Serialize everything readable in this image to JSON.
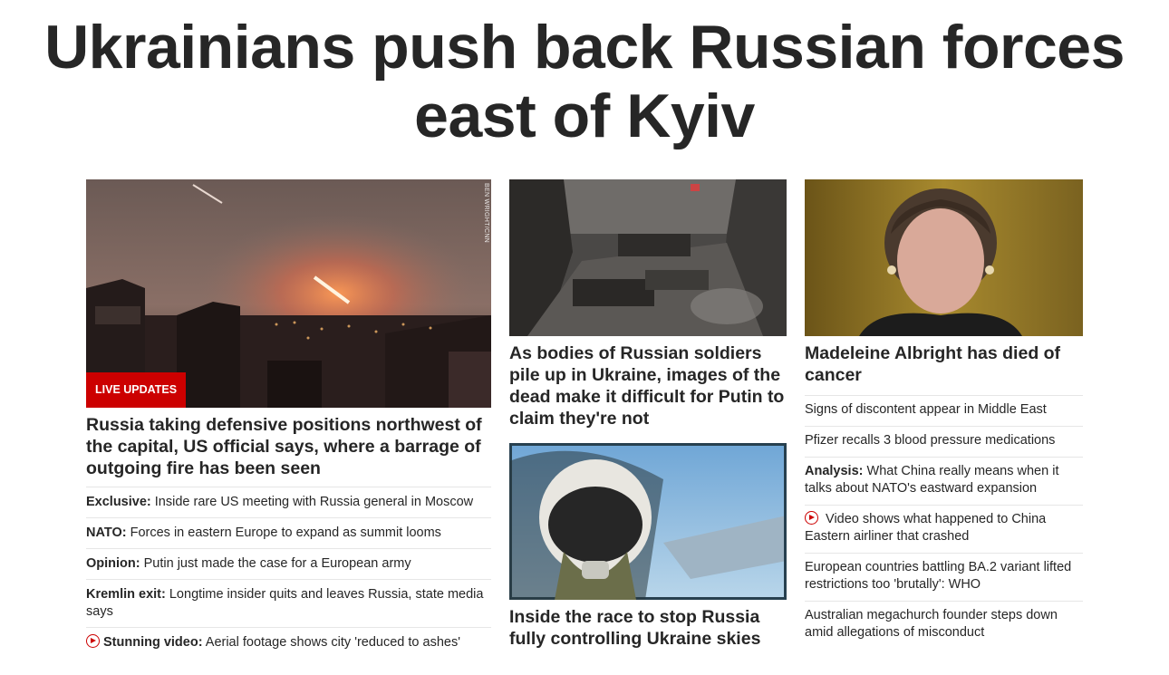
{
  "headline": "Ukrainians push back Russian forces east of Kyiv",
  "col1": {
    "image_credit": "BEN WRIGHT/CNN",
    "badge": "LIVE UPDATES",
    "lead": "Russia taking defensive positions northwest of the capital, US official says, where a barrage of outgoing fire has been seen",
    "items": [
      {
        "label": "Exclusive:",
        "text": " Inside rare US meeting with Russia general in Moscow",
        "video": false
      },
      {
        "label": "NATO:",
        "text": " Forces in eastern Europe to expand as summit looms",
        "video": false
      },
      {
        "label": "Opinion:",
        "text": " Putin just made the case for a European army",
        "video": false
      },
      {
        "label": "Kremlin exit:",
        "text": " Longtime insider quits and leaves Russia, state media says",
        "video": false
      },
      {
        "label": "Stunning video:",
        "text": " Aerial footage shows city 'reduced to ashes'",
        "video": true
      }
    ]
  },
  "col2": {
    "story1": "As bodies of Russian soldiers pile up in Ukraine, images of the dead make it difficult for Putin to claim they're not",
    "story2": "Inside the race to stop Russia fully controlling Ukraine skies"
  },
  "col3": {
    "lead": "Madeleine Albright has died of cancer",
    "items": [
      {
        "label": "",
        "text": "Signs of discontent appear in Middle East",
        "video": false
      },
      {
        "label": "",
        "text": "Pfizer recalls 3 blood pressure medications",
        "video": false
      },
      {
        "label": "Analysis:",
        "text": " What China really means when it talks about NATO's eastward expansion",
        "video": false
      },
      {
        "label": "",
        "text": " Video shows what happened to China Eastern airliner that crashed",
        "video": true
      },
      {
        "label": "",
        "text": "European countries battling BA.2 variant lifted restrictions too 'brutally': WHO",
        "video": false
      },
      {
        "label": "",
        "text": "Australian megachurch founder steps down amid allegations of misconduct",
        "video": false
      }
    ]
  }
}
